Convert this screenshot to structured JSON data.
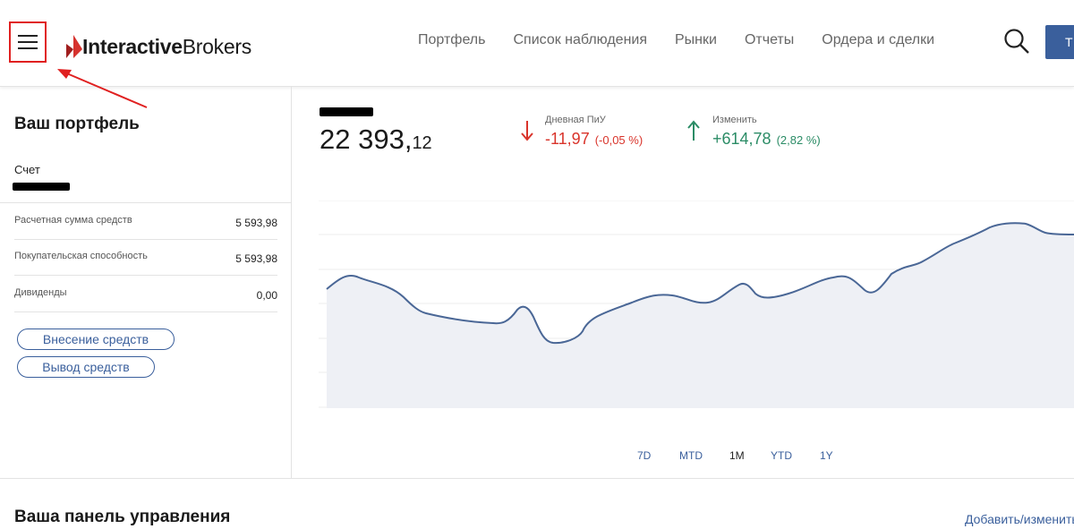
{
  "header": {
    "brand_bold": "Interactive",
    "brand_regular": "Brokers",
    "nav": [
      "Портфель",
      "Список наблюдения",
      "Рынки",
      "Отчеты",
      "Ордера и сделки"
    ],
    "top_button_label": "Т"
  },
  "portfolio": {
    "title": "Ваш портфель",
    "account_label": "Счет",
    "rows": [
      {
        "label": "Расчетная сумма средств",
        "value": "5 593,98"
      },
      {
        "label": "Покупательская способность",
        "value": "5 593,98"
      },
      {
        "label": "Дивиденды",
        "value": "0,00"
      }
    ],
    "deposit_label": "Внесение средств",
    "withdraw_label": "Вывод средств"
  },
  "summary": {
    "value_main": "22 393,",
    "value_cents": "12",
    "daily_label": "Дневная ПиУ",
    "daily_value": "-11,97",
    "daily_pct": "(-0,05 %)",
    "change_label": "Изменить",
    "change_value": "+614,78",
    "change_pct": "(2,82 %)"
  },
  "ranges": [
    "7D",
    "MTD",
    "1M",
    "YTD",
    "1Y"
  ],
  "active_range": "1M",
  "dashboard": {
    "title": "Ваша панель управления",
    "link": "Добавить/изменить"
  },
  "colors": {
    "accent": "#3a5f9c",
    "negative": "#d9342b",
    "positive": "#2b8c66",
    "highlight": "#e02020"
  }
}
